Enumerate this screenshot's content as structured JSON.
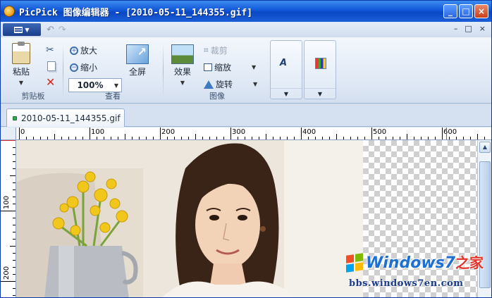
{
  "window": {
    "title": "PicPick 图像编辑器 - [2010-05-11_144355.gif]",
    "controls": {
      "minimize": "_",
      "maximize": "□",
      "close": "×"
    }
  },
  "quick_access": {
    "menu_icon": "menu-icon",
    "undo_icon": "undo-icon",
    "redo_icon": "redo-icon",
    "mdi": {
      "minimize": "–",
      "restore": "□",
      "close": "×"
    }
  },
  "ribbon": {
    "clipboard": {
      "group_label": "剪贴板",
      "paste_label": "粘贴",
      "cut_icon": "scissors-icon",
      "copy_icon": "copy-icon",
      "delete_icon": "delete-icon"
    },
    "view": {
      "group_label": "查看",
      "zoom_in_label": "放大",
      "zoom_out_label": "缩小",
      "zoom_value": "100%",
      "fullscreen_label": "全屏"
    },
    "image": {
      "group_label": "图像",
      "effects_label": "效果",
      "crop_label": "裁剪",
      "resize_label": "缩放",
      "rotate_label": "旋转"
    },
    "galleries": [
      {
        "icon": "text-effect-icon",
        "glyph": "A"
      },
      {
        "icon": "frame-icon"
      }
    ]
  },
  "document_tab": {
    "label": "2010-05-11_144355.gif"
  },
  "ruler": {
    "horizontal_labels": [
      "0",
      "100",
      "200",
      "300",
      "400",
      "500",
      "600"
    ],
    "vertical_labels": [
      "100",
      "200"
    ]
  },
  "watermark": {
    "brand": "Windows7",
    "accent": "之家",
    "url": "bbs.windows7en.com"
  },
  "colors": {
    "titlebar": "#1157d8",
    "ribbon_bg": "#dfe8f5",
    "ruler_marker": "#e03030",
    "watermark_blue": "#1d6fd1",
    "watermark_red": "#e2352b"
  }
}
